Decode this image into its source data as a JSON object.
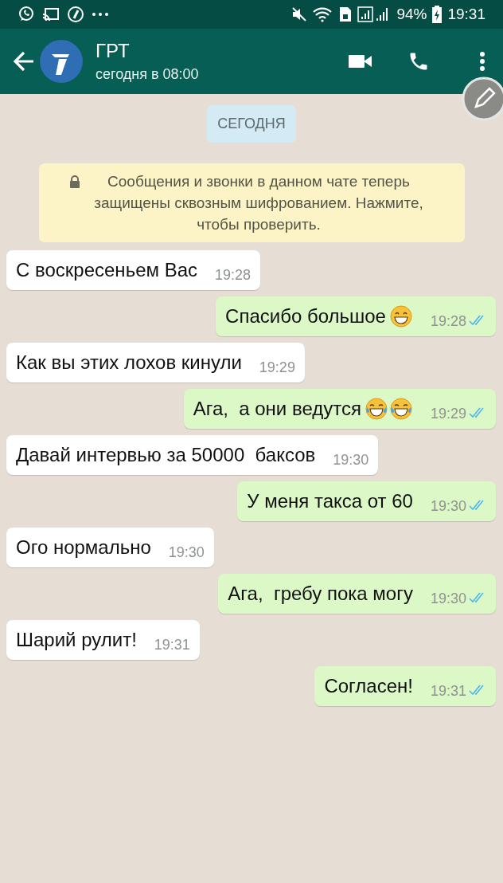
{
  "status_bar": {
    "battery": "94%",
    "time": "19:31"
  },
  "header": {
    "title": "ГРТ",
    "subtitle": "сегодня в 08:00"
  },
  "date_chip": "СЕГОДНЯ",
  "encryption_notice": "Сообщения и звонки в данном чате теперь защищены сквозным шифрованием. Нажмите, чтобы проверить.",
  "messages": [
    {
      "kind": "incoming",
      "text": "С воскресеньем Вас",
      "time": "19:28"
    },
    {
      "kind": "outgoing",
      "text": "Спасибо большое",
      "emoji": [
        {
          "kind": "grin"
        }
      ],
      "time": "19:28",
      "read": true
    },
    {
      "kind": "incoming",
      "text": "Как вы этих лохов кинули",
      "time": "19:29"
    },
    {
      "kind": "outgoing",
      "text": "Ага,  а они ведутся",
      "emoji": [
        {
          "kind": "tears_of_joy"
        },
        {
          "kind": "tears_of_joy"
        }
      ],
      "time": "19:29",
      "read": true
    },
    {
      "kind": "incoming",
      "text": "Давай интервью за 50000  баксов",
      "time": "19:30"
    },
    {
      "kind": "outgoing",
      "text": "У меня такса от 60",
      "time": "19:30",
      "read": true
    },
    {
      "kind": "incoming",
      "text": "Ого нормально",
      "time": "19:30"
    },
    {
      "kind": "outgoing",
      "text": "Ага,  гребу пока могу",
      "time": "19:30",
      "read": true
    },
    {
      "kind": "incoming",
      "text": "Шарий рулит!",
      "time": "19:31"
    },
    {
      "kind": "outgoing",
      "text": "Согласен!",
      "time": "19:31",
      "read": true
    }
  ]
}
